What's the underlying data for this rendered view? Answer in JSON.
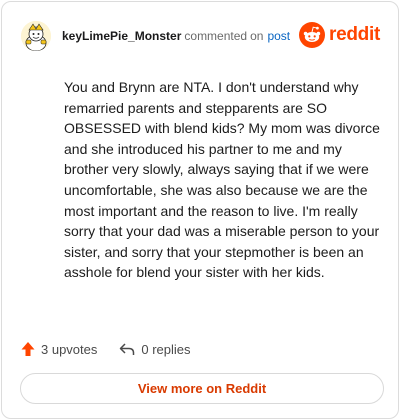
{
  "comment": {
    "username": "keyLimePie_Monster",
    "action_text": "commented",
    "on_text": "on",
    "post_link": "post",
    "body": "You and Brynn are NTA. I don't understand why remarried parents and stepparents are SO OBSESSED with blend kids? My mom was divorce and she introduced his partner to me and my brother very slowly, always saying that if we were uncomfortable, she was also because we are the most important and the reason to live. I'm really sorry that your dad was a miserable person to your sister, and sorry that your stepmother is been an asshole for blend your sister with her kids."
  },
  "brand": {
    "wordmark": "reddit",
    "icon": "reddit-snoo-icon",
    "color": "#ff4500"
  },
  "stats": {
    "upvotes": "3 upvotes",
    "upvote_icon": "upvote-arrow-icon",
    "upvote_color": "#ff4500",
    "replies": "0 replies",
    "reply_icon": "reply-arrow-icon"
  },
  "cta": {
    "label": "View more on Reddit",
    "color": "#d93a00"
  }
}
